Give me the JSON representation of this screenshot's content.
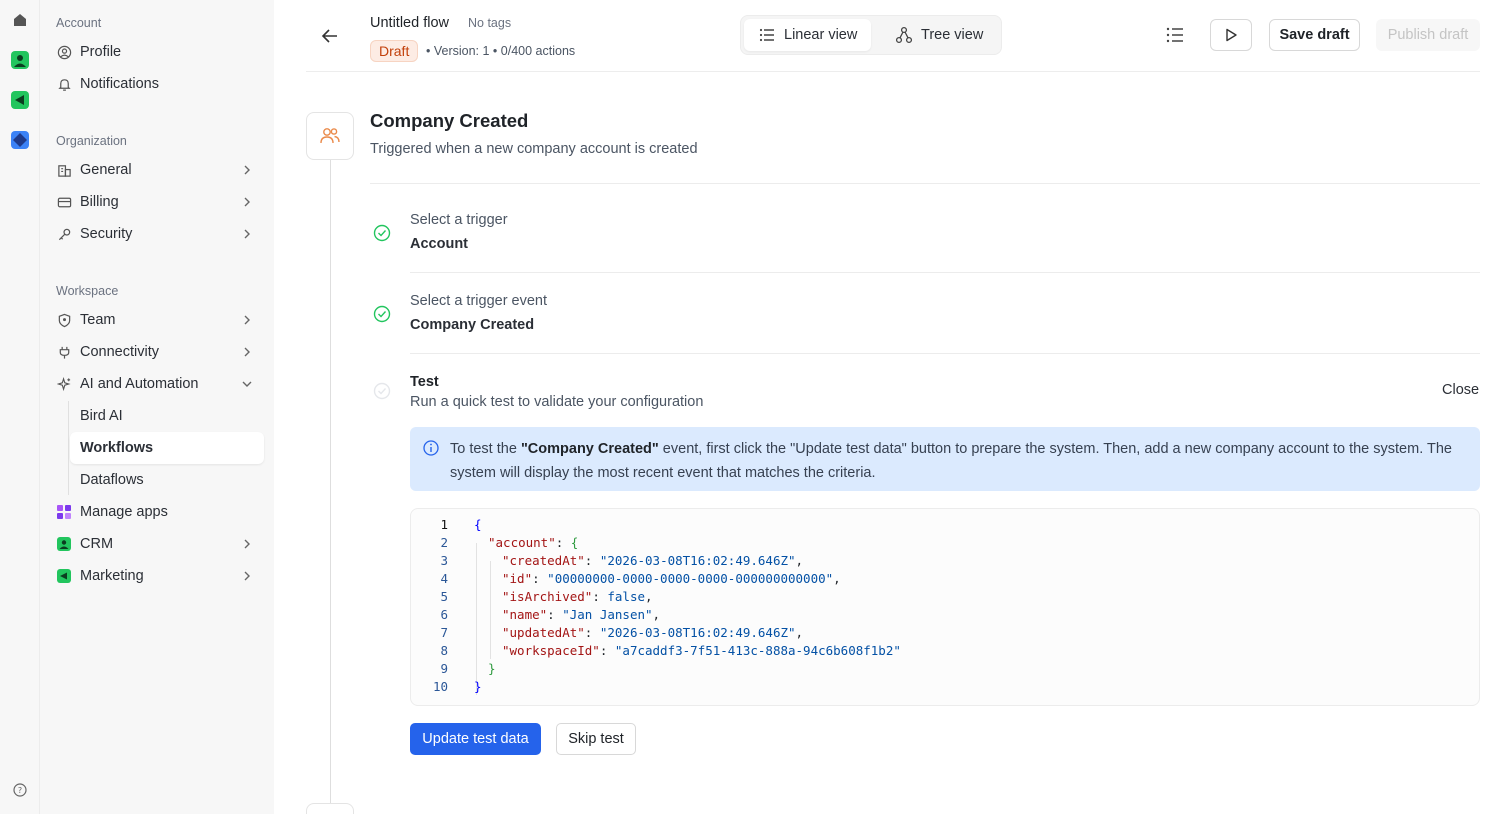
{
  "rail": {
    "icons": [
      "home-icon",
      "crm-app-icon",
      "marketing-app-icon",
      "bird-app-icon",
      "help-icon"
    ]
  },
  "sidebar": {
    "account_label": "Account",
    "account_items": [
      {
        "label": "Profile",
        "icon": "user-circle-icon"
      },
      {
        "label": "Notifications",
        "icon": "bell-icon"
      }
    ],
    "organization_label": "Organization",
    "organization_items": [
      {
        "label": "General",
        "icon": "building-icon"
      },
      {
        "label": "Billing",
        "icon": "credit-card-icon"
      },
      {
        "label": "Security",
        "icon": "key-icon"
      }
    ],
    "workspace_label": "Workspace",
    "workspace_items": [
      {
        "label": "Team",
        "icon": "shield-icon"
      },
      {
        "label": "Connectivity",
        "icon": "plug-icon"
      },
      {
        "label": "AI and Automation",
        "icon": "sparkle-icon",
        "expanded": true
      }
    ],
    "ai_subitems": [
      {
        "label": "Bird AI"
      },
      {
        "label": "Workflows",
        "active": true
      },
      {
        "label": "Dataflows"
      }
    ],
    "app_items": [
      {
        "label": "Manage apps",
        "icon": "apps-grid-icon"
      },
      {
        "label": "CRM",
        "icon": "crm-icon"
      },
      {
        "label": "Marketing",
        "icon": "marketing-icon"
      }
    ]
  },
  "header": {
    "title": "Untitled flow",
    "tags": "No tags",
    "status": "Draft",
    "version": "Version: 1",
    "actions_count": "0/400 actions",
    "linear_view": "Linear view",
    "tree_view": "Tree view",
    "save_draft": "Save draft",
    "publish_draft": "Publish draft"
  },
  "trigger": {
    "title": "Company Created",
    "description": "Triggered when a new company account is created",
    "step1_label": "Select a trigger",
    "step1_value": "Account",
    "step2_label": "Select a trigger event",
    "step2_value": "Company Created",
    "test_title": "Test",
    "test_desc": "Run a quick test to validate your configuration",
    "close": "Close"
  },
  "info": {
    "pre": "To test the ",
    "event": "\"Company Created\"",
    "post": " event, first click the \"Update test data\" button to prepare the system. Then, add a new company account to the system. The system will display the most recent event that matches the criteria."
  },
  "code": {
    "lines": [
      {
        "n": "1",
        "key": "",
        "value": "",
        "open": "{"
      },
      {
        "n": "2",
        "key": "\"account\"",
        "value": "",
        "open": "{"
      },
      {
        "n": "3",
        "key": "\"createdAt\"",
        "value": "\"2026-03-08T16:02:49.646Z\"",
        "comma": ","
      },
      {
        "n": "4",
        "key": "\"id\"",
        "value": "\"00000000-0000-0000-0000-000000000000\"",
        "comma": ","
      },
      {
        "n": "5",
        "key": "\"isArchived\"",
        "value": "false",
        "comma": ","
      },
      {
        "n": "6",
        "key": "\"name\"",
        "value": "\"Jan Jansen\"",
        "comma": ","
      },
      {
        "n": "7",
        "key": "\"updatedAt\"",
        "value": "\"2026-03-08T16:02:49.646Z\"",
        "comma": ","
      },
      {
        "n": "8",
        "key": "\"workspaceId\"",
        "value": "\"a7caddf3-7f51-413c-888a-94c6b608f1b2\"",
        "comma": ""
      },
      {
        "n": "9",
        "close": "}"
      },
      {
        "n": "10",
        "close": "}"
      }
    ]
  },
  "buttons": {
    "update": "Update test data",
    "skip": "Skip test"
  },
  "colors": {
    "primary": "#2563eb",
    "draft": "#c2410c",
    "success": "#22c55e",
    "info_bg": "#dbeafe"
  }
}
